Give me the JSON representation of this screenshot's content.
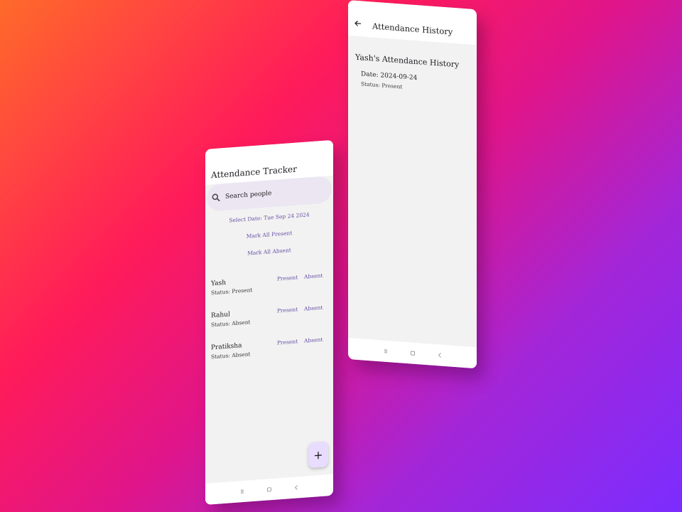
{
  "tracker": {
    "title": "Attendance Tracker",
    "search_placeholder": "Search people",
    "select_date_label": "Select Date: Tue Sep 24 2024",
    "mark_all_present_label": "Mark All Present",
    "mark_all_absent_label": "Mark All Absent",
    "present_label": "Present",
    "absent_label": "Absent",
    "people": [
      {
        "name": "Yash",
        "status": "Status: Present"
      },
      {
        "name": "Rahul",
        "status": "Status: Absent"
      },
      {
        "name": "Pratiksha",
        "status": "Status: Absent"
      }
    ],
    "fab_label": "+"
  },
  "history": {
    "title": "Attendance History",
    "heading": "Yash's Attendance History",
    "records": [
      {
        "date": "Date: 2024-09-24",
        "status": "Status: Present"
      }
    ]
  },
  "icons": {
    "search": "search-icon",
    "back": "back-arrow-icon",
    "nav_menu": "menu-icon",
    "nav_home": "home-square-icon",
    "nav_back": "chevron-left-icon"
  },
  "colors": {
    "accent": "#6750a4",
    "search_bg": "#ebe6f2",
    "fab_bg": "#e8ddff",
    "screen_bg": "#f2f2f2"
  }
}
